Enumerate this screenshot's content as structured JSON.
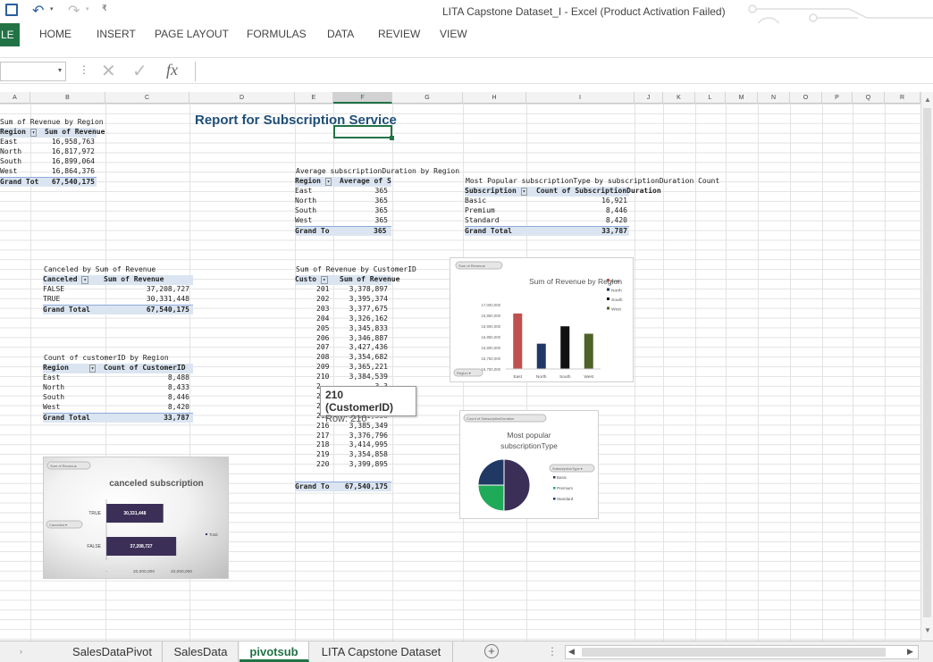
{
  "window": {
    "title": "LITA Capstone Dataset_I - Excel (Product Activation Failed)",
    "file_tab": "LE"
  },
  "ribbon": {
    "tabs": [
      "HOME",
      "INSERT",
      "PAGE LAYOUT",
      "FORMULAS",
      "DATA",
      "REVIEW",
      "VIEW"
    ]
  },
  "formula": {
    "fx": "fx",
    "name_box": "",
    "value": ""
  },
  "columns": [
    "A",
    "B",
    "C",
    "D",
    "E",
    "F",
    "G",
    "H",
    "I",
    "J",
    "K",
    "L",
    "M",
    "N",
    "O",
    "P",
    "Q",
    "R"
  ],
  "report_title": "Report for Subscription Service",
  "pivot_region": {
    "title": "Sum of Revenue by Region",
    "h1": "Region",
    "h2": "Sum of Revenue",
    "rows": [
      [
        "East",
        "16,958,763"
      ],
      [
        "North",
        "16,817,972"
      ],
      [
        "South",
        "16,899,064"
      ],
      [
        "West",
        "16,864,376"
      ]
    ],
    "total_label": "Grand Tot",
    "total": "67,540,175"
  },
  "pivot_avg": {
    "title": "Average subscriptionDuration by Region",
    "h1": "Region",
    "h2": "Average of SubscriptionDurat",
    "rows": [
      [
        "East",
        "365"
      ],
      [
        "North",
        "365"
      ],
      [
        "South",
        "365"
      ],
      [
        "West",
        "365"
      ]
    ],
    "total_label": "Grand To",
    "total": "365"
  },
  "pivot_popular": {
    "title": "Most Popular subscriptionType by subscriptionDuration Count",
    "h1": "Subscription",
    "h2": "Count of SubscriptionDuration",
    "rows": [
      [
        "Basic",
        "16,921"
      ],
      [
        "Premium",
        "8,446"
      ],
      [
        "Standard",
        "8,420"
      ]
    ],
    "total_label": "Grand Total",
    "total": "33,787"
  },
  "pivot_canceled": {
    "title": "Canceled by Sum of Revenue",
    "h1": "Canceled",
    "h2": "Sum of Revenue",
    "rows": [
      [
        "FALSE",
        "37,208,727"
      ],
      [
        "TRUE",
        "30,331,448"
      ]
    ],
    "total_label": "Grand Total",
    "total": "67,540,175"
  },
  "pivot_count": {
    "title": "Count of customerID by Region",
    "h1": "Region",
    "h2": "Count of CustomerID",
    "rows": [
      [
        "East",
        "8,488"
      ],
      [
        "North",
        "8,433"
      ],
      [
        "South",
        "8,446"
      ],
      [
        "West",
        "8,420"
      ]
    ],
    "total_label": "Grand Total",
    "total": "33,787"
  },
  "pivot_customer": {
    "title": "Sum of Revenue by CustomerID",
    "h1": "Custo",
    "h2": "Sum of Revenue",
    "rows": [
      [
        "201",
        "3,378,897"
      ],
      [
        "202",
        "3,395,374"
      ],
      [
        "203",
        "3,377,675"
      ],
      [
        "204",
        "3,326,162"
      ],
      [
        "205",
        "3,345,833"
      ],
      [
        "206",
        "3,346,887"
      ],
      [
        "207",
        "3,427,436"
      ],
      [
        "208",
        "3,354,682"
      ],
      [
        "209",
        "3,365,221"
      ],
      [
        "210",
        "3,384,539"
      ],
      [
        "2",
        "3,3"
      ],
      [
        "2",
        "3,3"
      ],
      [
        "214",
        "3,351,209"
      ],
      [
        "215",
        "3,361,350"
      ],
      [
        "216",
        "3,385,349"
      ],
      [
        "217",
        "3,376,796"
      ],
      [
        "218",
        "3,414,995"
      ],
      [
        "219",
        "3,354,858"
      ],
      [
        "220",
        "3,399,895"
      ]
    ],
    "total_label": "Grand To",
    "total": "67,540,175"
  },
  "tooltip": {
    "title": "210  (CustomerID)",
    "row": "Row: 210"
  },
  "chart_bar_region": {
    "button": "Sum of Revenue",
    "title": "Sum of Revenue by Region",
    "axis_button": "Region"
  },
  "chart_pie": {
    "button": "Count of SubscriptionDuration",
    "title": "Most popular subscriptionType",
    "legend_button": "SubscriptionType"
  },
  "chart_canceled": {
    "button": "Sum of Revenue",
    "title": "canceled subscription",
    "axis_button": "Canceled",
    "legend": "Total"
  },
  "chart_data": [
    {
      "type": "bar",
      "title": "Sum of Revenue by Region",
      "categories": [
        "East",
        "North",
        "South",
        "West"
      ],
      "series": [
        {
          "name": "East",
          "values": [
            16958763
          ]
        },
        {
          "name": "North",
          "values": [
            16817972
          ]
        },
        {
          "name": "South",
          "values": [
            16899064
          ]
        },
        {
          "name": "West",
          "values": [
            16864376
          ]
        }
      ],
      "values": [
        16958763,
        16817972,
        16899064,
        16864376
      ],
      "ylim": [
        16700000,
        17000000
      ],
      "yticks": [
        "17,000,000",
        "16,950,000",
        "16,900,000",
        "16,850,000",
        "16,800,000",
        "16,750,000",
        "16,700,000"
      ],
      "colors": [
        "#c0504d",
        "#1f3864",
        "#111111",
        "#4f6228"
      ],
      "legend": [
        "East",
        "North",
        "South",
        "West"
      ],
      "legend_position": "right"
    },
    {
      "type": "pie",
      "title": "Most popular subscriptionType",
      "categories": [
        "Basic",
        "Premium",
        "Standard"
      ],
      "values": [
        16921,
        8446,
        8420
      ],
      "colors": [
        "#3b2e57",
        "#1faa59",
        "#1f3864"
      ],
      "legend": [
        "Basic",
        "Premium",
        "Standard"
      ],
      "legend_position": "right"
    },
    {
      "type": "bar",
      "orientation": "horizontal",
      "title": "canceled subscription",
      "categories": [
        "TRUE",
        "FALSE"
      ],
      "values": [
        30331448,
        37208727
      ],
      "labels": [
        "30,331,448",
        "37,208,727"
      ],
      "xticks": [
        "-",
        "20,000,000",
        "40,000,000"
      ],
      "xlim": [
        0,
        40000000
      ],
      "legend": [
        "Total"
      ],
      "color": "#3b2e57"
    }
  ],
  "sheets": {
    "tabs": [
      "SalesDataPivot",
      "SalesData",
      "pivotsub",
      "LITA Capstone Dataset"
    ],
    "active": "pivotsub"
  }
}
